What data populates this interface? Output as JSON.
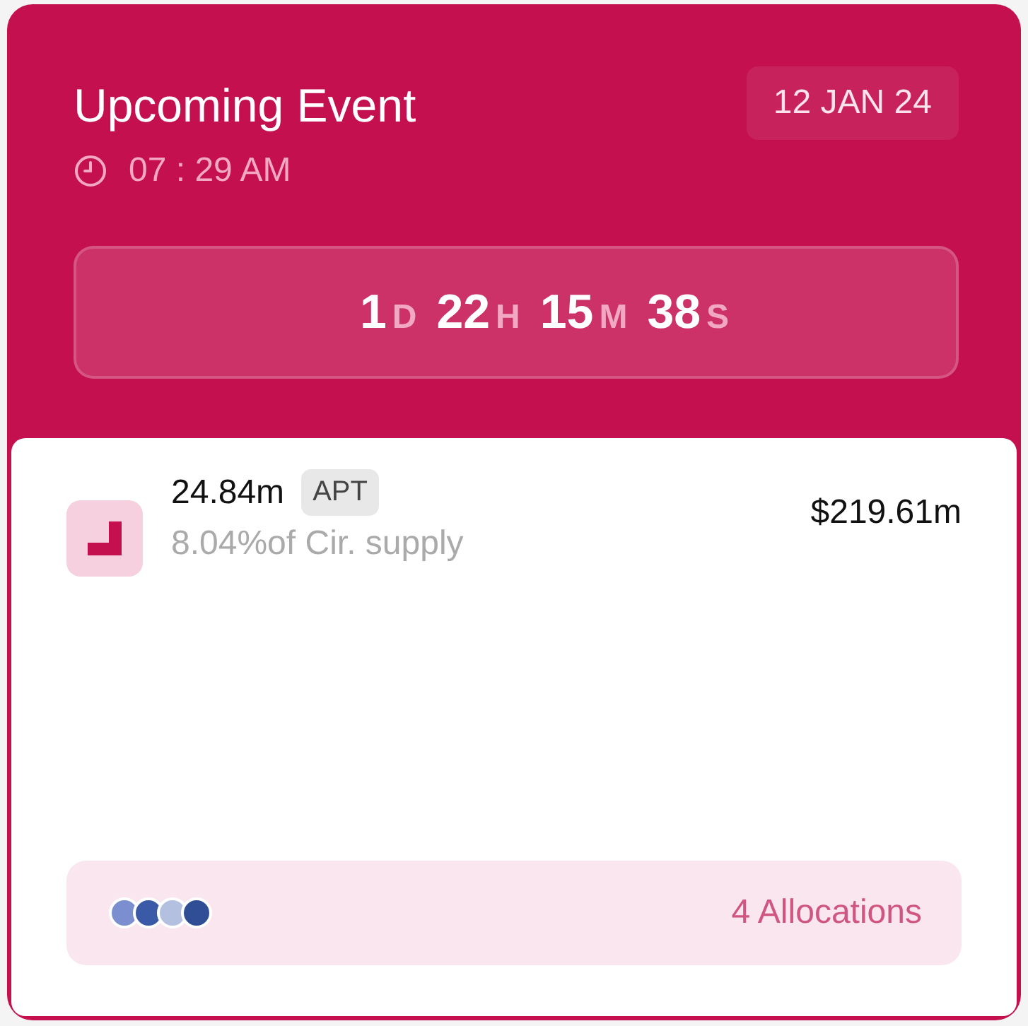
{
  "event": {
    "title": "Upcoming Event",
    "time": "07 : 29 AM",
    "date": "12 JAN 24"
  },
  "countdown": [
    {
      "value": "1",
      "unit": "D"
    },
    {
      "value": "22",
      "unit": "H"
    },
    {
      "value": "15",
      "unit": "M"
    },
    {
      "value": "38",
      "unit": "S"
    }
  ],
  "token": {
    "amount": "24.84m",
    "symbol": "APT",
    "supply": "8.04%of Cir. supply",
    "value": "$219.61m"
  },
  "allocations": {
    "avatars": [
      {
        "color": "#7b8fd0"
      },
      {
        "color": "#3a5aa8"
      },
      {
        "color": "#b3c0e0"
      },
      {
        "color": "#2f4e95"
      }
    ],
    "label": "4 Allocations"
  }
}
